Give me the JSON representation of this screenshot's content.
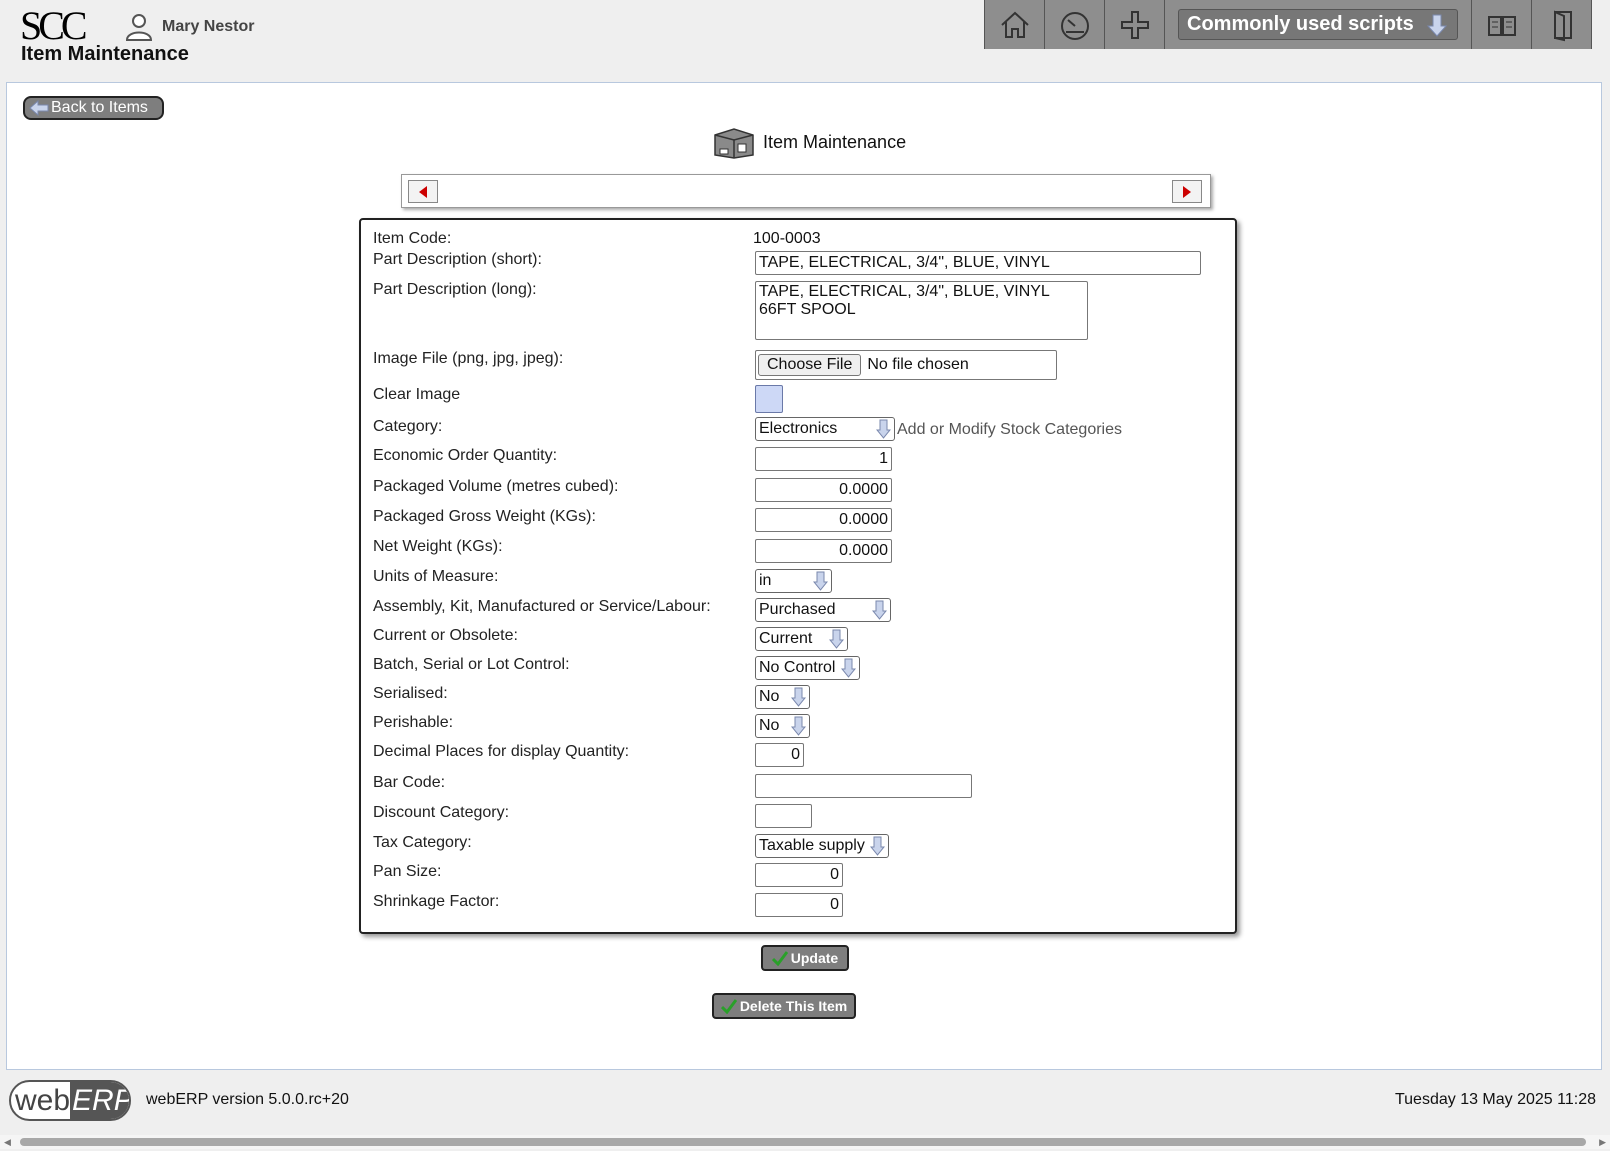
{
  "header": {
    "logo_text": "SCC",
    "user_name": "Mary Nestor",
    "page_heading": "Item Maintenance",
    "scripts_label": "Commonly used scripts"
  },
  "main": {
    "back_label": "Back to Items",
    "title": "Item Maintenance"
  },
  "form": {
    "item_code": {
      "label": "Item Code:",
      "value": "100-0003"
    },
    "desc_short": {
      "label": "Part Description (short):",
      "value": "TAPE, ELECTRICAL, 3/4\", BLUE, VINYL"
    },
    "desc_long": {
      "label": "Part Description (long):",
      "value": "TAPE, ELECTRICAL, 3/4\", BLUE, VINYL\n66FT SPOOL"
    },
    "image_file": {
      "label": "Image File (png, jpg, jpeg):",
      "button": "Choose File",
      "status": "No file chosen"
    },
    "clear_image": {
      "label": "Clear Image",
      "checked": false
    },
    "category": {
      "label": "Category:",
      "value": "Electronics",
      "link": "Add or Modify Stock Categories"
    },
    "eoq": {
      "label": "Economic Order Quantity:",
      "value": "1"
    },
    "volume": {
      "label": "Packaged Volume (metres cubed):",
      "value": "0.0000"
    },
    "gross_weight": {
      "label": "Packaged Gross Weight (KGs):",
      "value": "0.0000"
    },
    "net_weight": {
      "label": "Net Weight (KGs):",
      "value": "0.0000"
    },
    "uom": {
      "label": "Units of Measure:",
      "value": "in"
    },
    "mbflag": {
      "label": "Assembly, Kit, Manufactured or Service/Labour:",
      "value": "Purchased"
    },
    "discontinued": {
      "label": "Current or Obsolete:",
      "value": "Current"
    },
    "controlled": {
      "label": "Batch, Serial or Lot Control:",
      "value": "No Control"
    },
    "serialised": {
      "label": "Serialised:",
      "value": "No"
    },
    "perishable": {
      "label": "Perishable:",
      "value": "No"
    },
    "decimal_places": {
      "label": "Decimal Places for display Quantity:",
      "value": "0"
    },
    "barcode": {
      "label": "Bar Code:",
      "value": ""
    },
    "discount_category": {
      "label": "Discount Category:",
      "value": ""
    },
    "tax_category": {
      "label": "Tax Category:",
      "value": "Taxable supply"
    },
    "pan_size": {
      "label": "Pan Size:",
      "value": "0"
    },
    "shrinkage": {
      "label": "Shrinkage Factor:",
      "value": "0"
    }
  },
  "buttons": {
    "update": "Update",
    "delete": "Delete This Item"
  },
  "footer": {
    "logo_web": "web",
    "logo_erp": "ERP",
    "version": "webERP version 5.0.0.rc+20",
    "datetime": "Tuesday 13 May 2025 11:28"
  },
  "icons": {
    "home": "home-icon",
    "dashboard": "dashboard-icon",
    "add": "plus-icon",
    "manual": "book-icon",
    "logout": "logout-door-icon",
    "item": "box-icon",
    "prev": "left-arrow-icon",
    "next": "right-arrow-icon",
    "confirm": "check-icon"
  },
  "colors": {
    "nav_bg": "#8e8e8e",
    "button_bg": "#7e7e7e",
    "arrow_red": "#cc0000",
    "check_green": "#2aa02a"
  }
}
